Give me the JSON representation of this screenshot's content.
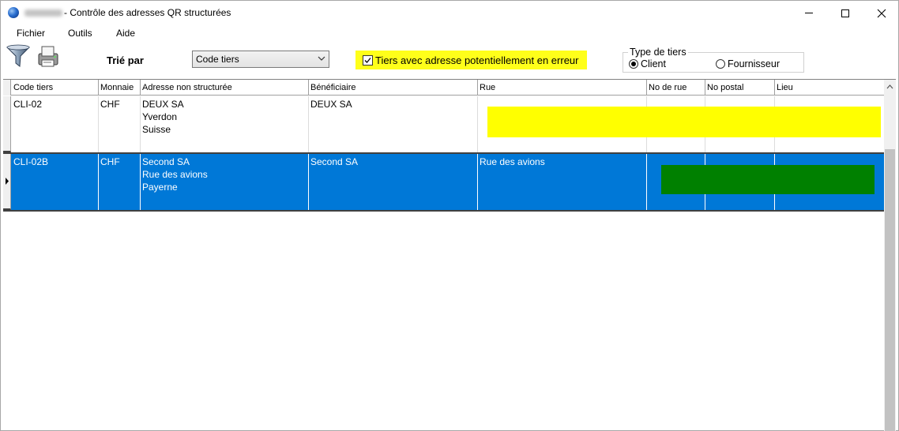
{
  "window": {
    "title": "- Contrôle des adresses QR structurées"
  },
  "menu": {
    "items": [
      "Fichier",
      "Outils",
      "Aide"
    ]
  },
  "toolbar": {
    "sort_label": "Trié par",
    "sort_value": "Code tiers",
    "error_filter_label": "Tiers avec adresse potentiellement en erreur",
    "error_filter_checked": true,
    "tiers_type": {
      "legend": "Type de tiers",
      "options": [
        "Client",
        "Fournisseur"
      ],
      "selected": "Client"
    }
  },
  "grid": {
    "columns": [
      "Code tiers",
      "Monnaie",
      "Adresse non structurée",
      "Bénéficiaire",
      "Rue",
      "No de rue",
      "No postal",
      "Lieu"
    ],
    "rows": [
      {
        "code": "CLI-02",
        "currency": "CHF",
        "address": [
          "DEUX SA",
          "Yverdon",
          "Suisse"
        ],
        "beneficiary": "DEUX SA",
        "street": "",
        "street_no": "",
        "postal": "",
        "city": "",
        "status_color": "#ffff00"
      },
      {
        "code": "CLI-02B",
        "currency": "CHF",
        "address": [
          "Second SA",
          "Rue des avions",
          "Payerne"
        ],
        "beneficiary": "Second SA",
        "street": "Rue des avions",
        "street_no": "",
        "postal": "",
        "city": "",
        "status_color": "#008000"
      }
    ]
  },
  "colors": {
    "selection": "#0078d7",
    "filter_highlight": "#ffff1a"
  }
}
